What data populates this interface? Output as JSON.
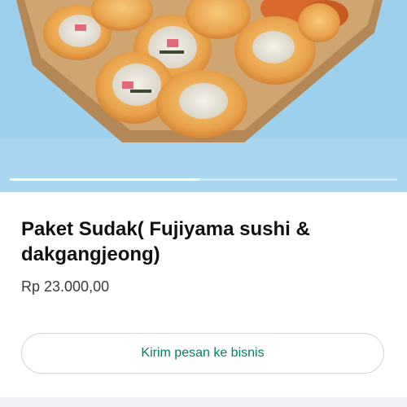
{
  "product": {
    "image_alt_icon": "product-photo",
    "title": "Paket Sudak( Fujiyama sushi & dakgangjeong)",
    "price": "Rp 23.000,00"
  },
  "carousel": {
    "progress_fraction": 0.49
  },
  "actions": {
    "message_label": "Kirim pesan ke bisnis"
  },
  "colors": {
    "accent": "#008069",
    "photo_bg": "#9dd0ec"
  }
}
